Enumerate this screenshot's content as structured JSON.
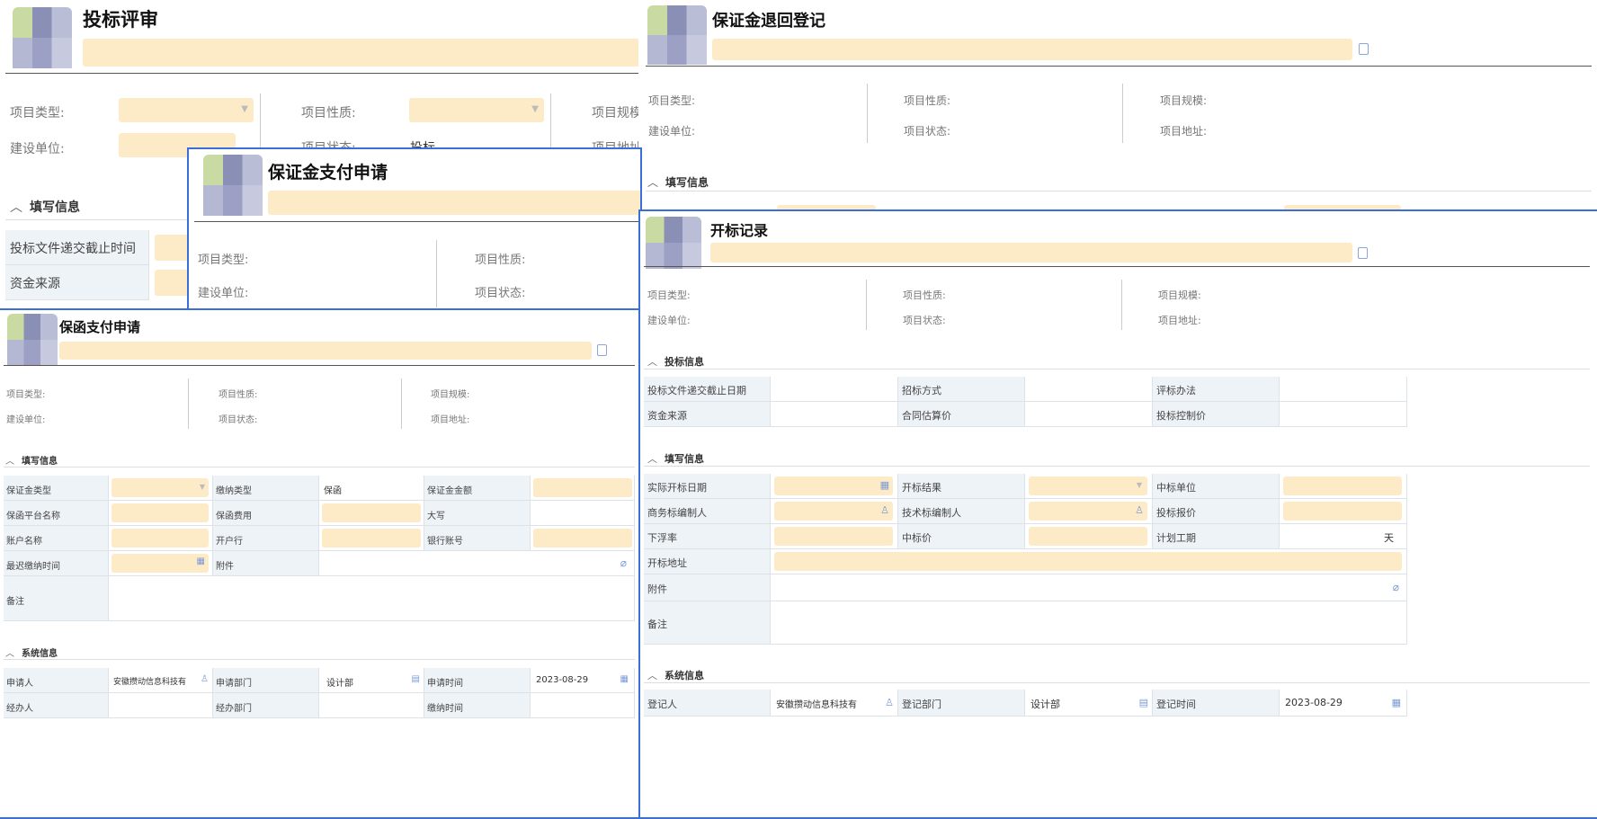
{
  "p1": {
    "title": "投标评审",
    "project_type": "项目类型:",
    "project_nature": "项目性质:",
    "project_scale": "项目规模",
    "build_unit": "建设单位:",
    "project_status": "项目状态:",
    "status_value": "投标",
    "project_address": "项目地址",
    "fill_info": "填写信息",
    "bid_deadline": "投标文件递交截止时间",
    "fund_source": "资金来源"
  },
  "p2": {
    "title": "保证金退回登记",
    "project_type": "项目类型:",
    "project_nature": "项目性质:",
    "project_scale": "项目规模:",
    "build_unit": "建设单位:",
    "project_status": "项目状态:",
    "project_address": "项目地址:",
    "fill_info": "填写信息"
  },
  "p3": {
    "title": "保证金支付申请",
    "project_type": "项目类型:",
    "project_nature": "项目性质:",
    "build_unit": "建设单位:",
    "project_status": "项目状态:"
  },
  "p4": {
    "title": "保函支付申请",
    "project_type": "项目类型:",
    "project_nature": "项目性质:",
    "project_scale": "项目规模:",
    "build_unit": "建设单位:",
    "project_status": "项目状态:",
    "project_address": "项目地址:",
    "fill_info": "填写信息",
    "deposit_type": "保证金类型",
    "pay_type": "缴纳类型",
    "pay_type_value": "保函",
    "deposit_amount": "保证金金额",
    "platform": "保函平台名称",
    "fee": "保函费用",
    "capital": "大写",
    "account_name": "账户名称",
    "bank": "开户行",
    "bank_account": "银行账号",
    "latest_time": "最迟缴纳时间",
    "attachment": "附件",
    "remark": "备注",
    "sys_info": "系统信息",
    "applicant": "申请人",
    "applicant_value": "安徽攒动信息科技有",
    "apply_dept": "申请部门",
    "apply_dept_value": "设计部",
    "apply_time": "申请时间",
    "apply_time_value": "2023-08-29",
    "handler": "经办人",
    "handle_dept": "经办部门",
    "pay_time": "缴纳时间"
  },
  "p5": {
    "title": "开标记录",
    "project_type": "项目类型:",
    "project_nature": "项目性质:",
    "project_scale": "项目规模:",
    "build_unit": "建设单位:",
    "project_status": "项目状态:",
    "project_address": "项目地址:",
    "bid_info": "投标信息",
    "bid_deadline": "投标文件递交截止日期",
    "tender_method": "招标方式",
    "eval_method": "评标办法",
    "fund_source": "资金来源",
    "contract_est": "合同估算价",
    "bid_ctrl": "投标控制价",
    "fill_info": "填写信息",
    "actual_date": "实际开标日期",
    "open_result": "开标结果",
    "winner": "中标单位",
    "biz_editor": "商务标编制人",
    "tech_editor": "技术标编制人",
    "bid_quote": "投标报价",
    "float_rate": "下浮率",
    "win_price": "中标价",
    "plan_period": "计划工期",
    "period_unit": "天",
    "open_addr": "开标地址",
    "attachment": "附件",
    "remark": "备注",
    "sys_info": "系统信息",
    "registrant": "登记人",
    "registrant_value": "安徽攒动信息科技有",
    "reg_dept": "登记部门",
    "reg_dept_value": "设计部",
    "reg_time": "登记时间",
    "reg_time_value": "2023-08-29"
  }
}
